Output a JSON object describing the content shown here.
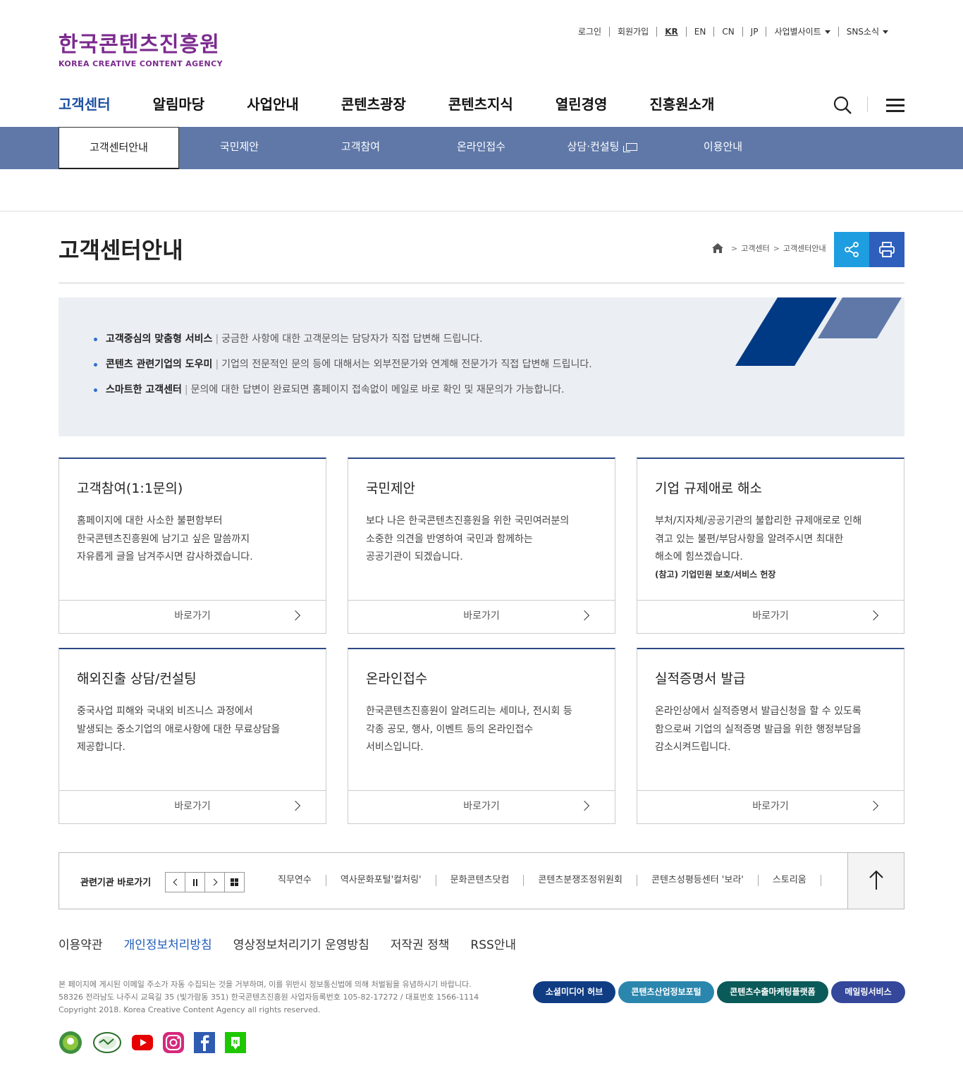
{
  "util": {
    "items": [
      "로그인",
      "회원가입",
      "KR",
      "EN",
      "CN",
      "JP",
      "사업별사이트",
      "SNS소식"
    ]
  },
  "logo": {
    "ko": "한국콘텐츠진흥원",
    "en": "KOREA CREATIVE CONTENT AGENCY"
  },
  "gnb": [
    "고객센터",
    "알림마당",
    "사업안내",
    "콘텐츠광장",
    "콘텐츠지식",
    "열린경영",
    "진흥원소개"
  ],
  "subnav": [
    "고객센터안내",
    "국민제안",
    "고객참여",
    "온라인접수",
    "상담·컨설팅",
    "이용안내"
  ],
  "page": {
    "title": "고객센터안내",
    "crumbs": [
      "고객센터",
      "고객센터안내"
    ]
  },
  "intro": [
    {
      "title": "고객중심의 맞춤형 서비스",
      "text": "궁금한 사항에 대한 고객문의는 담당자가 직접 답변해 드립니다."
    },
    {
      "title": "콘텐츠 관련기업의 도우미",
      "text": "기업의 전문적인 문의 등에 대해서는 외부전문가와 연계해 전문가가 직접 답변해 드립니다."
    },
    {
      "title": "스마트한 고객센터",
      "text": "문의에 대한 답변이 완료되면 홈페이지 접속없이 메일로 바로 확인 및 재문의가 가능합니다."
    }
  ],
  "cards": [
    {
      "title": "고객참여(1:1문의)",
      "lines": [
        "홈페이지에 대한 사소한 불편함부터",
        "한국콘텐츠진흥원에 남기고 싶은 말씀까지",
        "자유롭게 글을 남겨주시면 감사하겠습니다."
      ],
      "note": "",
      "go": "바로가기"
    },
    {
      "title": "국민제안",
      "lines": [
        "보다 나은 한국콘텐츠진흥원을 위한 국민여러분의",
        "소중한 의견을 반영하여 국민과 함께하는",
        "공공기관이 되겠습니다."
      ],
      "note": "",
      "go": "바로가기"
    },
    {
      "title": "기업 규제애로 해소",
      "lines": [
        "부처/지자체/공공기관의 불합리한 규제애로로 인해",
        "겪고 있는 불편/부담사항을 알려주시면 최대한",
        "해소에 힘쓰겠습니다."
      ],
      "note": "(참고) 기업민원 보호/서비스 헌장",
      "go": "바로가기"
    },
    {
      "title": "해외진출 상담/컨설팅",
      "lines": [
        "중국사업 피해와 국내외 비즈니스 과정에서",
        "발생되는 중소기업의 애로사항에 대한 무료상담을",
        "제공합니다."
      ],
      "note": "",
      "go": "바로가기"
    },
    {
      "title": "온라인접수",
      "lines": [
        "한국콘텐츠진흥원이 알려드리는 세미나, 전시회 등",
        "각종 공모, 행사, 이벤트 등의 온라인접수",
        "서비스입니다."
      ],
      "note": "",
      "go": "바로가기"
    },
    {
      "title": "실적증명서 발급",
      "lines": [
        "온라인상에서 실적증명서 발급신청을 할 수 있도록",
        "함으로써 기업의 실적증명 발급을 위한 행정부담을",
        "감소시켜드립니다."
      ],
      "note": "",
      "go": "바로가기"
    }
  ],
  "related": {
    "label": "관련기관 바로가기",
    "links": [
      "직무연수",
      "역사문화포털'컬처링'",
      "문화콘텐츠닷컴",
      "콘텐츠분쟁조정위원회",
      "콘텐츠성평등센터 '보라'",
      "스토리움"
    ]
  },
  "footer": {
    "links": [
      "이용약관",
      "개인정보처리방침",
      "영상정보처리기기 운영방침",
      "저작권 정책",
      "RSS안내"
    ],
    "info": [
      "본 페이지에 게시된 이메일 주소가 자동 수집되는 것을 거부하며, 이를 위반시 정보통신법에 의해 처벌됨을 유념하시기 바랍니다.",
      "58326 전라남도 나주시 교육길 35 (빛가람동 351) 한국콘텐츠진흥원 사업자등록번호 105-82-17272 / 대표번호 1566-1114",
      "Copyright 2018. Korea Creative Content Agency all rights reserved."
    ],
    "buttons": [
      {
        "label": "소셜미디어 허브",
        "color": "#0f3c83"
      },
      {
        "label": "콘텐츠산업정보포털",
        "color": "#2b86ae"
      },
      {
        "label": "콘텐츠수출마케팅플랫폼",
        "color": "#0b5a5a"
      },
      {
        "label": "메일링서비스",
        "color": "#34479a"
      }
    ]
  },
  "colors": {
    "accent": "#1c4fa0",
    "subnav": "#5f78a8",
    "logo": "#7b2a8e",
    "share": "#1e9ee0",
    "print": "#2f5fbd"
  }
}
